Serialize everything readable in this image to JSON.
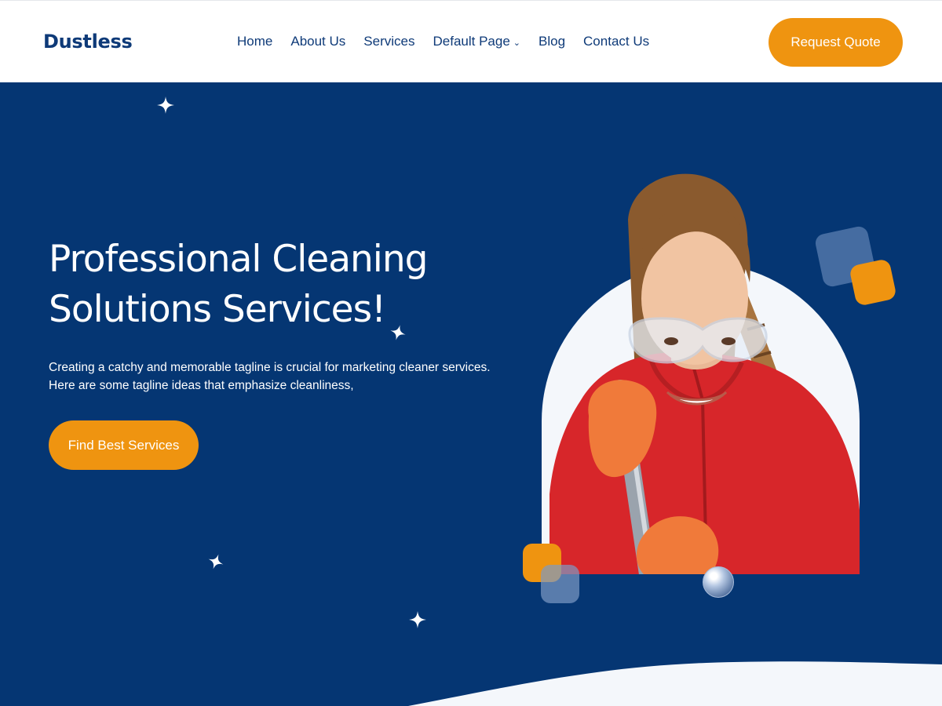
{
  "brand": {
    "name": "Dustless"
  },
  "nav": {
    "items": [
      {
        "label": "Home"
      },
      {
        "label": "About Us"
      },
      {
        "label": "Services"
      },
      {
        "label": "Default Page"
      },
      {
        "label": "Blog"
      },
      {
        "label": "Contact Us"
      }
    ],
    "cta_label": "Request Quote"
  },
  "hero": {
    "title_line1": "Professional Cleaning",
    "title_line2": "Solutions Services!",
    "subtitle_line1": "Creating a catchy and memorable tagline is crucial for marketing cleaner services.",
    "subtitle_line2": "Here are some tagline ideas that emphasize cleanliness,",
    "cta_label": "Find Best Services"
  },
  "colors": {
    "primary": "#053673",
    "accent": "#ef9410",
    "text_dark": "#0e3a78",
    "light_bg": "#f4f7fb"
  },
  "icons": {
    "dropdown": "chevron-down-icon",
    "sparkle": "sparkle-icon"
  }
}
